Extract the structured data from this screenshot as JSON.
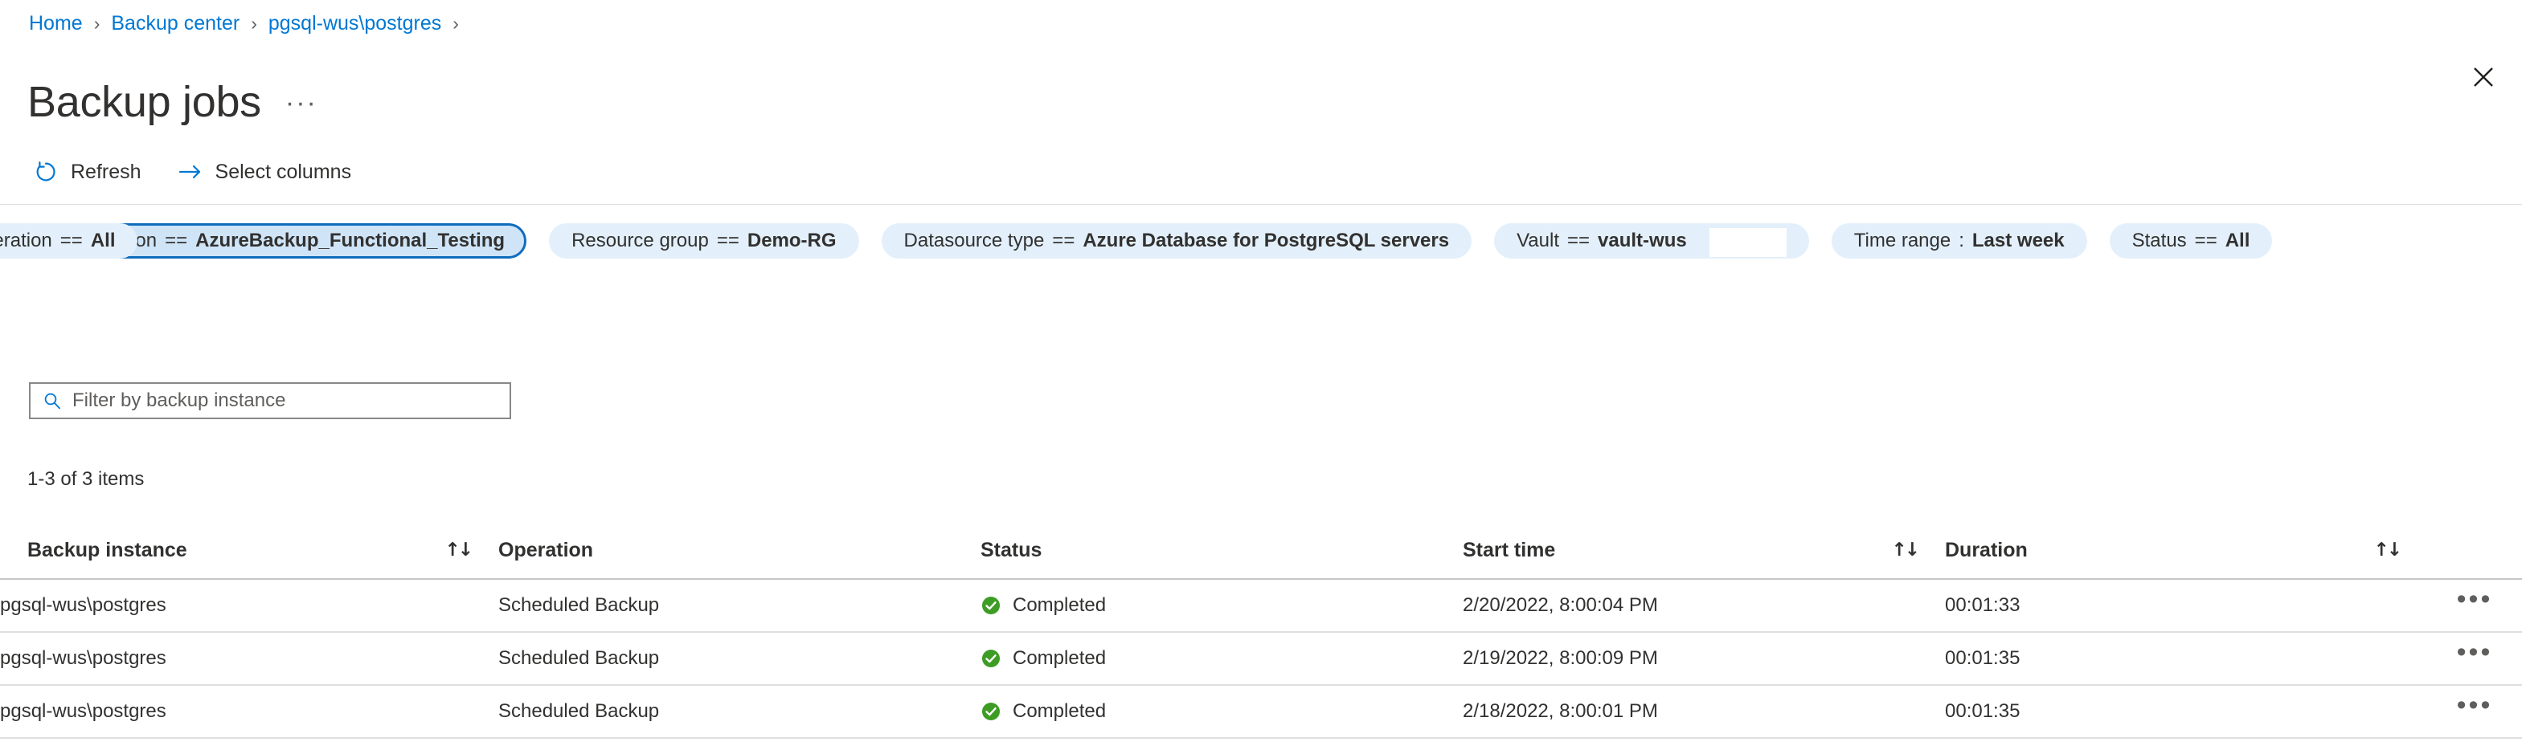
{
  "breadcrumb": {
    "items": [
      {
        "label": "Home"
      },
      {
        "label": "Backup center"
      },
      {
        "label": "pgsql-wus\\postgres"
      }
    ],
    "separator": "›"
  },
  "header": {
    "title": "Backup jobs",
    "ellipsis": "···",
    "close_icon": "close-icon"
  },
  "toolbar": {
    "refresh_label": "Refresh",
    "refresh_icon": "refresh-icon",
    "select_columns_label": "Select columns",
    "select_columns_icon": "arrow-right-icon"
  },
  "filters": [
    {
      "key": "Subscription",
      "op": "==",
      "value": "AzureBackup_Functional_Testing",
      "selected": true
    },
    {
      "key": "Resource group",
      "op": "==",
      "value": "Demo-RG",
      "selected": false
    },
    {
      "key": "Datasource type",
      "op": "==",
      "value": "Azure Database for PostgreSQL servers",
      "selected": false
    },
    {
      "key": "Vault",
      "op": "==",
      "value": "vault-wus",
      "selected": false
    },
    {
      "key": "Time range",
      "op": ":",
      "value": "Last week",
      "selected": false
    },
    {
      "key": "Status",
      "op": "==",
      "value": "All",
      "selected": false
    },
    {
      "key": "Operation",
      "op": "==",
      "value": "All",
      "selected": false
    }
  ],
  "search": {
    "placeholder": "Filter by backup instance",
    "value": "",
    "icon": "search-icon"
  },
  "summary": {
    "count_text": "1-3 of 3 items"
  },
  "table": {
    "sort_icon": "sort-ascending-descending-icon",
    "columns": [
      {
        "label": "Backup instance",
        "sortable": true
      },
      {
        "label": "Operation",
        "sortable": false
      },
      {
        "label": "Status",
        "sortable": false
      },
      {
        "label": "Start time",
        "sortable": true
      },
      {
        "label": "Duration",
        "sortable": true
      },
      {
        "label": "",
        "sortable": false
      }
    ],
    "rows": [
      {
        "backup_instance": "pgsql-wus\\postgres",
        "operation": "Scheduled Backup",
        "status": "Completed",
        "status_icon": "success-check-icon",
        "start_time": "2/20/2022, 8:00:04 PM",
        "duration": "00:01:33",
        "menu": "•••"
      },
      {
        "backup_instance": "pgsql-wus\\postgres",
        "operation": "Scheduled Backup",
        "status": "Completed",
        "status_icon": "success-check-icon",
        "start_time": "2/19/2022, 8:00:09 PM",
        "duration": "00:01:35",
        "menu": "•••"
      },
      {
        "backup_instance": "pgsql-wus\\postgres",
        "operation": "Scheduled Backup",
        "status": "Completed",
        "status_icon": "success-check-icon",
        "start_time": "2/18/2022, 8:00:01 PM",
        "duration": "00:01:35",
        "menu": "•••"
      }
    ]
  },
  "colors": {
    "link": "#0078d4",
    "pill_background": "#e3f0fb",
    "pill_selected_background": "#cfe4f7",
    "pill_selected_border": "#0f6cbd",
    "success_green": "#107c10",
    "text_primary": "#323130",
    "text_secondary": "#605e5c"
  }
}
